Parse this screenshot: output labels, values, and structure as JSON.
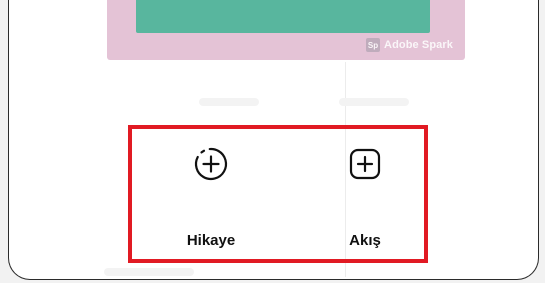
{
  "preview": {
    "watermark_text": "Adobe Spark",
    "colors": {
      "outer": "#e4c3d6",
      "inner": "#58b69e"
    }
  },
  "create_options": [
    {
      "label": "Hikaye",
      "icon": "dashed-circle-plus-icon"
    },
    {
      "label": "Akış",
      "icon": "square-plus-icon"
    }
  ],
  "highlight_color": "#e11a23"
}
